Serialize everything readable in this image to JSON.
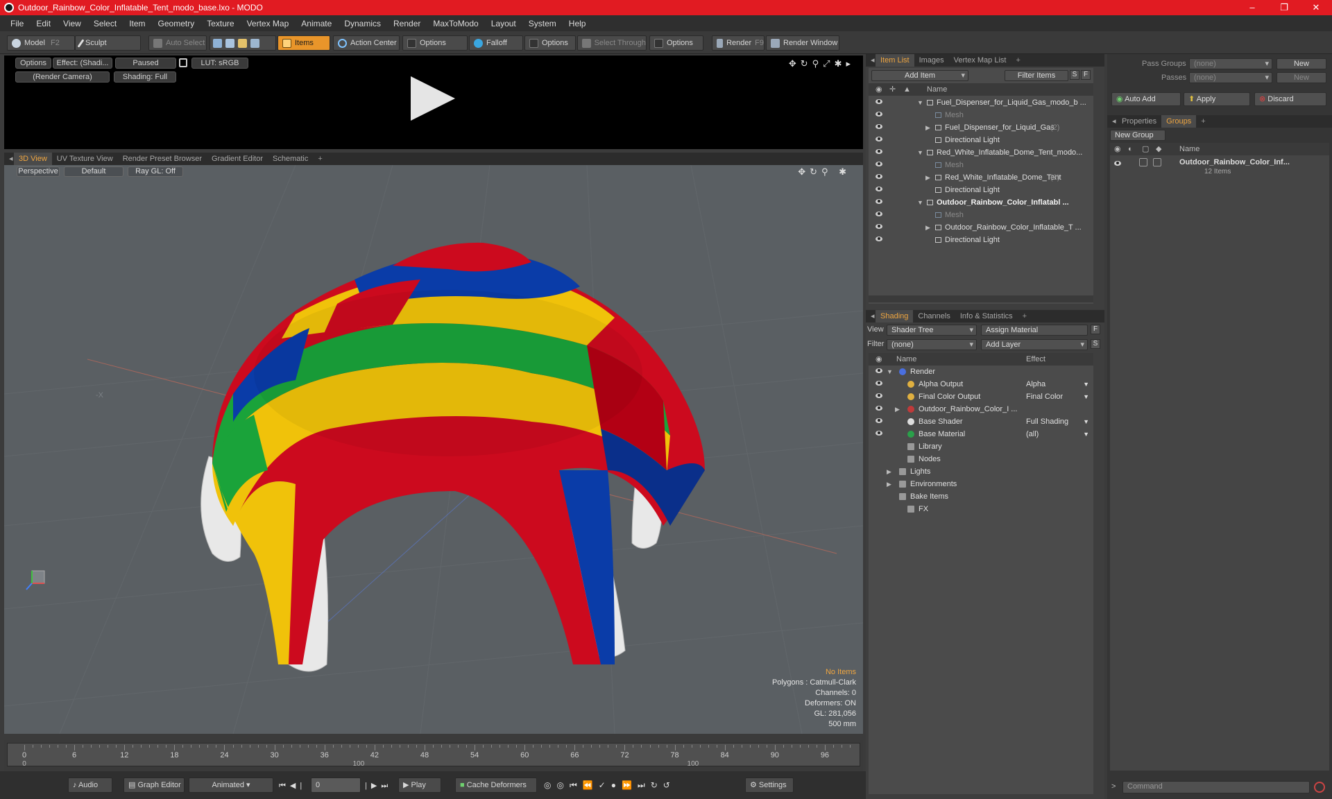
{
  "window": {
    "title": "Outdoor_Rainbow_Color_Inflatable_Tent_modo_base.lxo - MODO",
    "controls": [
      "–",
      "❐",
      "✕"
    ]
  },
  "menu": [
    "File",
    "Edit",
    "View",
    "Select",
    "Item",
    "Geometry",
    "Texture",
    "Vertex Map",
    "Animate",
    "Dynamics",
    "Render",
    "MaxToModo",
    "Layout",
    "System",
    "Help"
  ],
  "toolbar": {
    "model": "Model",
    "model_key": "F2",
    "sculpt": "Sculpt",
    "auto_select": "Auto Select",
    "items": "Items",
    "action_center": "Action Center",
    "options1": "Options",
    "falloff": "Falloff",
    "options2": "Options",
    "select_through": "Select Through",
    "options3": "Options",
    "render": "Render",
    "render_key": "F9",
    "render_window": "Render Window"
  },
  "preview": {
    "options": "Options",
    "effect": "Effect: (Shadi...",
    "paused": "Paused",
    "lut": "LUT: sRGB",
    "camera": "(Render Camera)",
    "shading": "Shading: Full"
  },
  "viewport_tabs": [
    "3D View",
    "UV Texture View",
    "Render Preset Browser",
    "Gradient Editor",
    "Schematic",
    "+"
  ],
  "viewport": {
    "projection": "Perspective",
    "style": "Default",
    "raygl": "Ray GL: Off",
    "axis_label": "-X",
    "hud": {
      "no_items": "No Items",
      "polygons": "Polygons : Catmull-Clark",
      "channels": "Channels: 0",
      "deformers": "Deformers: ON",
      "gl": "GL: 281,056",
      "scale": "500 mm"
    }
  },
  "timeline": {
    "major": [
      "0",
      "6",
      "12",
      "18",
      "24",
      "30",
      "36",
      "42",
      "48",
      "54",
      "60",
      "66",
      "72",
      "78",
      "84",
      "90",
      "96"
    ],
    "minor": [
      "0",
      "100",
      "100"
    ]
  },
  "bottom": {
    "audio": "Audio",
    "graph_editor": "Graph Editor",
    "animated": "Animated",
    "frame": "0",
    "play": "Play",
    "cache_deformers": "Cache Deformers",
    "settings": "Settings"
  },
  "item_list": {
    "tabs": [
      "Item List",
      "Images",
      "Vertex Map List",
      "+"
    ],
    "add_item": "Add Item",
    "filter_items": "Filter Items",
    "s_btn": "S",
    "f_btn": "F",
    "col_name": "Name",
    "rows": [
      {
        "label": "Fuel_Dispenser_for_Liquid_Gas_modo_b ...",
        "style": "normal"
      },
      {
        "label": "Mesh",
        "style": "dim"
      },
      {
        "label": "Fuel_Dispenser_for_Liquid_Gas",
        "count": "(2)",
        "style": "normal"
      },
      {
        "label": "Directional Light",
        "style": "normal"
      },
      {
        "label": "Red_White_Inflatable_Dome_Tent_modo...",
        "style": "normal"
      },
      {
        "label": "Mesh",
        "style": "dim"
      },
      {
        "label": "Red_White_Inflatable_Dome_Tent",
        "count": "(2)",
        "style": "normal"
      },
      {
        "label": "Directional Light",
        "style": "normal"
      },
      {
        "label": "Outdoor_Rainbow_Color_Inflatabl ...",
        "style": "bold"
      },
      {
        "label": "Mesh",
        "style": "dim"
      },
      {
        "label": "Outdoor_Rainbow_Color_Inflatable_T ...",
        "style": "normal"
      },
      {
        "label": "Directional Light",
        "style": "normal"
      }
    ]
  },
  "shading": {
    "tabs": [
      "Shading",
      "Channels",
      "Info & Statistics",
      "+"
    ],
    "view_label": "View",
    "view_value": "Shader Tree",
    "assign_material": "Assign Material",
    "filter_label": "Filter",
    "filter_value": "(none)",
    "add_layer": "Add Layer",
    "f_btn": "F",
    "s_btn": "S",
    "col_name": "Name",
    "col_effect": "Effect",
    "rows": [
      {
        "label": "Render",
        "effect": ""
      },
      {
        "label": "Alpha Output",
        "effect": "Alpha"
      },
      {
        "label": "Final Color Output",
        "effect": "Final Color"
      },
      {
        "label": "Outdoor_Rainbow_Color_I ...",
        "effect": ""
      },
      {
        "label": "Base Shader",
        "effect": "Full Shading"
      },
      {
        "label": "Base Material",
        "effect": "(all)"
      },
      {
        "label": "Library",
        "effect": ""
      },
      {
        "label": "Nodes",
        "effect": ""
      },
      {
        "label": "Lights",
        "effect": ""
      },
      {
        "label": "Environments",
        "effect": ""
      },
      {
        "label": "Bake Items",
        "effect": ""
      },
      {
        "label": "FX",
        "effect": ""
      }
    ]
  },
  "groups": {
    "pass_groups_label": "Pass Groups",
    "pass_groups_value": "(none)",
    "passes_label": "Passes",
    "passes_value": "(none)",
    "new_btn": "New",
    "new_btn2": "New",
    "auto_add": "Auto Add",
    "apply": "Apply",
    "discard": "Discard",
    "tabs": [
      "Properties",
      "Groups",
      "+"
    ],
    "new_group": "New Group",
    "col_name": "Name",
    "group_name": "Outdoor_Rainbow_Color_Inf...",
    "group_count": "12 Items"
  },
  "command": {
    "placeholder": "Command"
  },
  "colors": {
    "title_red": "#e11b22",
    "accent_orange": "#f0a640",
    "tent_red": "#cc0a1e",
    "tent_blue": "#0a3ca8",
    "tent_green": "#1aa33a",
    "tent_yellow": "#f0c20a"
  }
}
